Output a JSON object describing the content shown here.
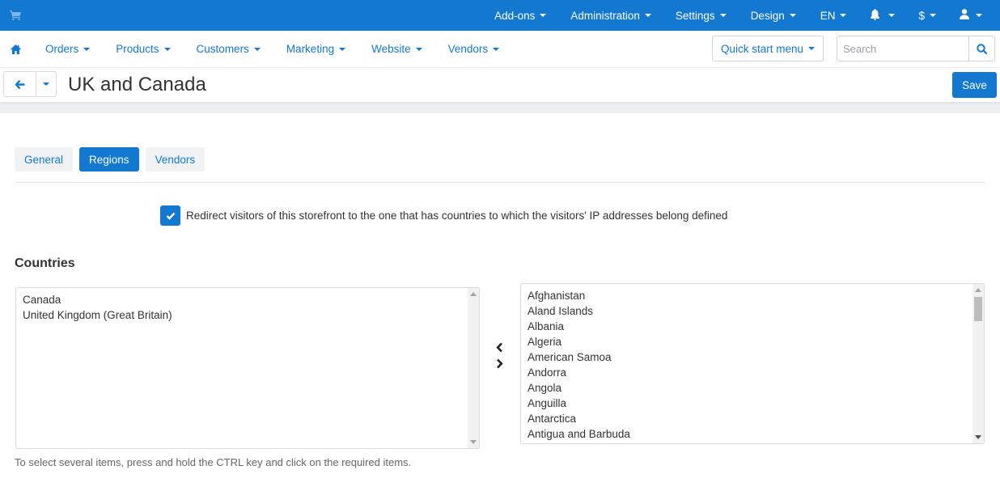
{
  "colors": {
    "brand": "#1278d0",
    "page_bg": "#ffffff",
    "band": "#edf0f3"
  },
  "topbar": {
    "logo_icon": "cart-icon",
    "menu": [
      {
        "label": "Add-ons"
      },
      {
        "label": "Administration"
      },
      {
        "label": "Settings"
      },
      {
        "label": "Design"
      },
      {
        "label": "EN"
      },
      {
        "icon": "bell-icon"
      },
      {
        "label": "$"
      },
      {
        "icon": "user-icon"
      }
    ]
  },
  "navbar": {
    "home_icon": "home-icon",
    "items": [
      {
        "label": "Orders"
      },
      {
        "label": "Products"
      },
      {
        "label": "Customers"
      },
      {
        "label": "Marketing"
      },
      {
        "label": "Website"
      },
      {
        "label": "Vendors"
      }
    ],
    "quick_start": "Quick start menu",
    "search": {
      "placeholder": "Search",
      "value": ""
    }
  },
  "header": {
    "title": "UK and Canada",
    "save_label": "Save"
  },
  "tabs": [
    {
      "label": "General",
      "active": false
    },
    {
      "label": "Regions",
      "active": true
    },
    {
      "label": "Vendors",
      "active": false
    }
  ],
  "redirect": {
    "checked": true,
    "label": "Redirect visitors of this storefront to the one that has countries to which the visitors' IP addresses belong defined"
  },
  "countries": {
    "title": "Countries",
    "selected": [
      "Canada",
      "United Kingdom (Great Britain)"
    ],
    "available": [
      "Afghanistan",
      "Aland Islands",
      "Albania",
      "Algeria",
      "American Samoa",
      "Andorra",
      "Angola",
      "Anguilla",
      "Antarctica",
      "Antigua and Barbuda"
    ],
    "hint": "To select several items, press and hold the CTRL key and click on the required items."
  }
}
